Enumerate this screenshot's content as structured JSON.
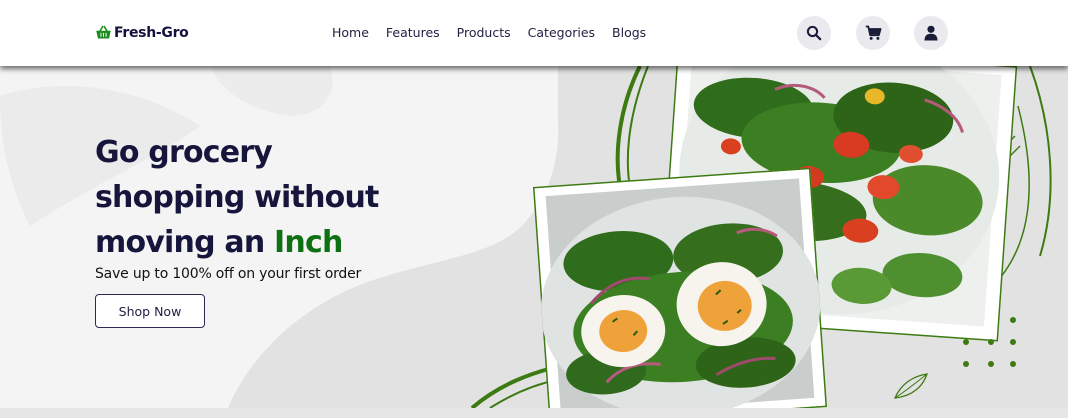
{
  "header": {
    "logo_text": "Fresh-Gro",
    "logo_icon": "basket-icon",
    "nav": [
      {
        "label": "Home"
      },
      {
        "label": "Features"
      },
      {
        "label": "Products"
      },
      {
        "label": "Categories"
      },
      {
        "label": "Blogs"
      }
    ],
    "actions": [
      {
        "icon": "search-icon"
      },
      {
        "icon": "cart-icon"
      },
      {
        "icon": "user-icon"
      }
    ]
  },
  "hero": {
    "title_line1": "Go grocery",
    "title_line2": "shopping without",
    "title_line3_prefix": "moving an ",
    "title_highlight": "Inch",
    "subtitle": "Save up to 100% off on your first order",
    "cta_label": "Shop Now"
  },
  "colors": {
    "brand_dark": "#16163d",
    "brand_green": "#0e7013",
    "accent_green": "#3d7a12",
    "background": "#f4f4f4"
  }
}
